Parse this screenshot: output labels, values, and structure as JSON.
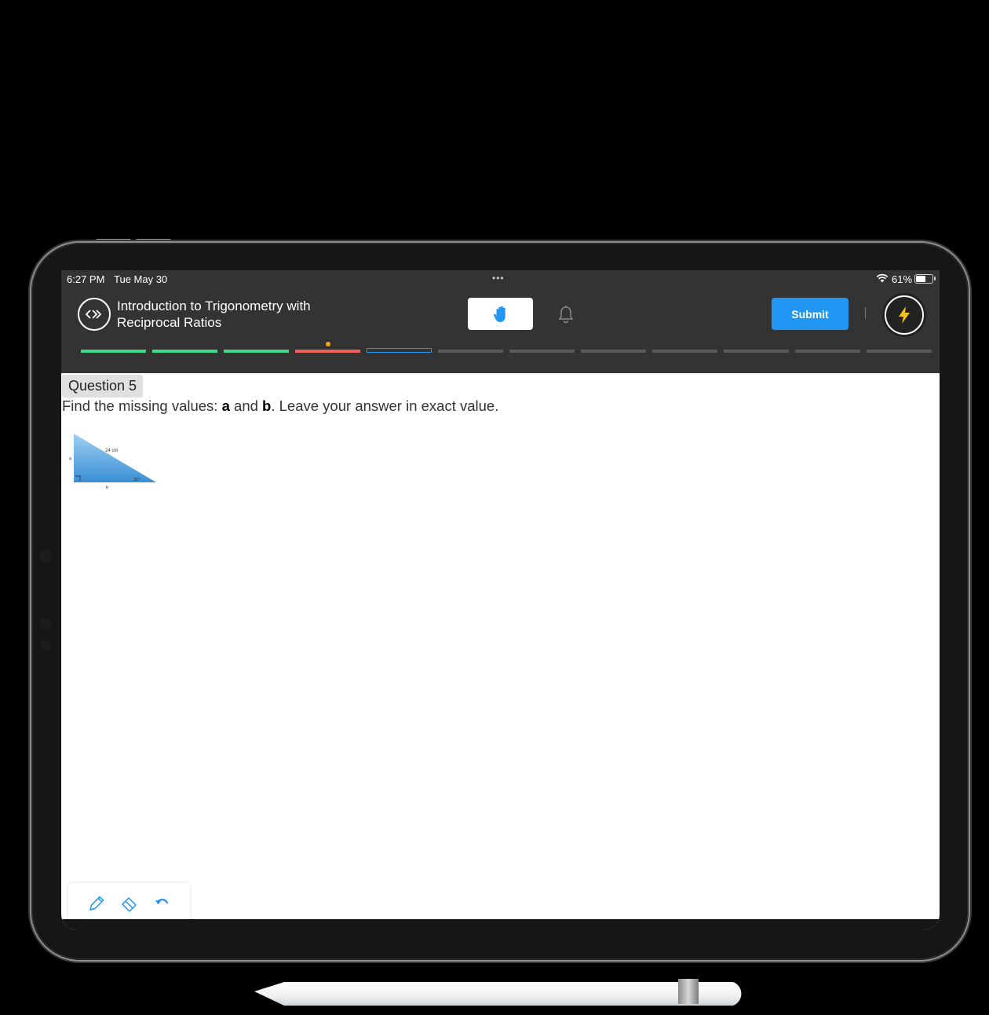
{
  "status_bar": {
    "time": "6:27 PM",
    "date": "Tue May 30",
    "dots": "•••",
    "battery_percent": "61%",
    "battery_level": 0.61
  },
  "header": {
    "course_title_line1": "Introduction to Trigonometry with",
    "course_title_line2": "Reciprocal Ratios",
    "submit_label": "Submit",
    "divider_text": "|"
  },
  "progress": {
    "segments": [
      {
        "state": "done",
        "color": "#3ddc84"
      },
      {
        "state": "done",
        "color": "#3ddc84"
      },
      {
        "state": "done",
        "color": "#3ddc84"
      },
      {
        "state": "incorrect",
        "color": "#f0605d",
        "marker_color": "#f5a623"
      },
      {
        "state": "current",
        "color": "#2196f3"
      },
      {
        "state": "todo",
        "color": "#5a5a5a"
      },
      {
        "state": "todo",
        "color": "#5a5a5a"
      },
      {
        "state": "todo",
        "color": "#5a5a5a"
      },
      {
        "state": "todo",
        "color": "#5a5a5a"
      },
      {
        "state": "todo",
        "color": "#5a5a5a"
      },
      {
        "state": "todo",
        "color": "#5a5a5a"
      },
      {
        "state": "todo",
        "color": "#5a5a5a"
      }
    ]
  },
  "question": {
    "label": "Question 5",
    "text_before": "Find the missing values: ",
    "var_a": "a",
    "text_mid": " and ",
    "var_b": "b",
    "text_after": ". Leave your answer in exact value."
  },
  "figure": {
    "hypotenuse_label": "24 cm",
    "side_a_label": "a",
    "side_b_label": "b",
    "angle_label": "35°"
  },
  "toolbar": {
    "tools": [
      "pencil-icon",
      "eraser-icon",
      "undo-icon"
    ]
  },
  "colors": {
    "accent": "#2196f3",
    "header_bg": "#333333",
    "bolt": "#f5c518"
  }
}
